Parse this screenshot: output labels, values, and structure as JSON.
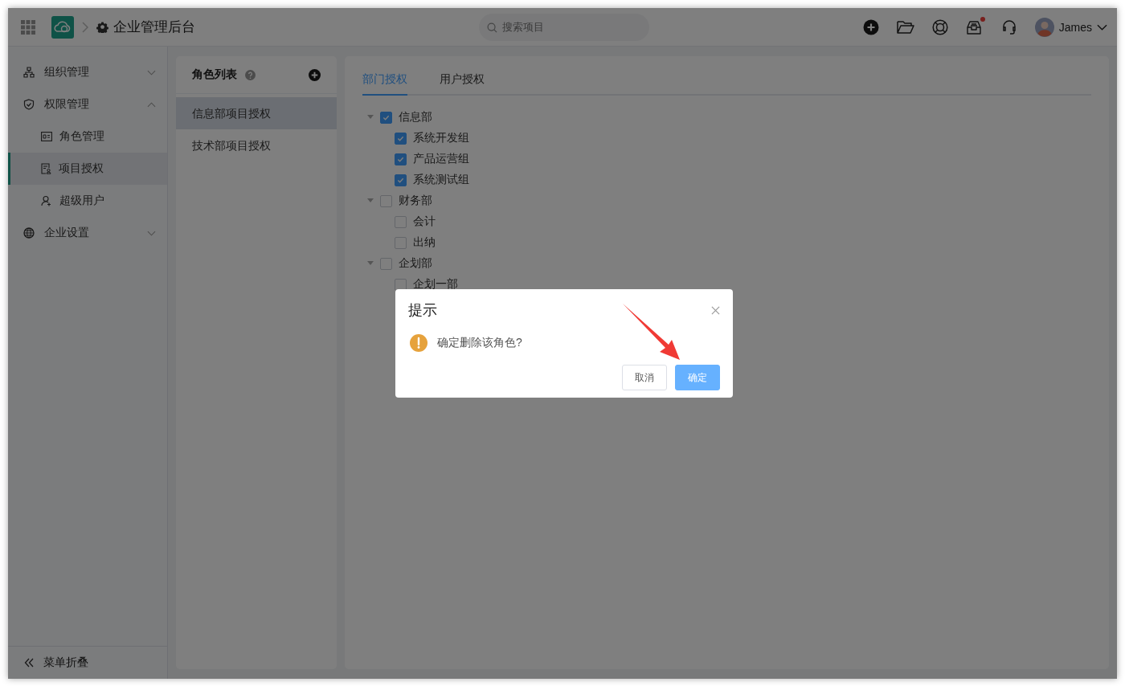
{
  "header": {
    "title": "企业管理后台",
    "search": {
      "placeholder": "搜索项目"
    },
    "toolbar": [
      {
        "kind": "add"
      },
      {
        "kind": "folder"
      },
      {
        "kind": "help"
      },
      {
        "kind": "inbox",
        "badge": true
      },
      {
        "kind": "support"
      }
    ],
    "user": {
      "name": "James"
    }
  },
  "sidebar": {
    "items": [
      {
        "label": "组织管理",
        "expanded": false
      },
      {
        "label": "权限管理",
        "expanded": true,
        "children": [
          {
            "label": "角色管理",
            "selected": false
          },
          {
            "label": "项目授权",
            "selected": true
          },
          {
            "label": "超级用户",
            "selected": false
          }
        ]
      },
      {
        "label": "企业设置",
        "expanded": false
      }
    ],
    "collapse_label": "菜单折叠"
  },
  "roles": {
    "title": "角色列表",
    "items": [
      {
        "label": "信息部项目授权",
        "selected": true
      },
      {
        "label": "技术部项目授权",
        "selected": false
      }
    ]
  },
  "tabs": [
    {
      "label": "部门授权",
      "selected": true
    },
    {
      "label": "用户授权",
      "selected": false
    }
  ],
  "tree": [
    {
      "label": "信息部",
      "checked": true,
      "expanded": true,
      "children": [
        {
          "label": "系统开发组",
          "checked": true
        },
        {
          "label": "产品运营组",
          "checked": true
        },
        {
          "label": "系统测试组",
          "checked": true
        }
      ]
    },
    {
      "label": "财务部",
      "checked": false,
      "expanded": true,
      "children": [
        {
          "label": "会计",
          "checked": false
        },
        {
          "label": "出纳",
          "checked": false
        }
      ]
    },
    {
      "label": "企划部",
      "checked": false,
      "expanded": true,
      "children": [
        {
          "label": "企划一部",
          "checked": false
        }
      ]
    }
  ],
  "dialog": {
    "title": "提示",
    "message": "确定删除该角色?",
    "buttons": [
      {
        "label": "取消",
        "kind": "default"
      },
      {
        "label": "确定",
        "kind": "primary"
      }
    ]
  }
}
